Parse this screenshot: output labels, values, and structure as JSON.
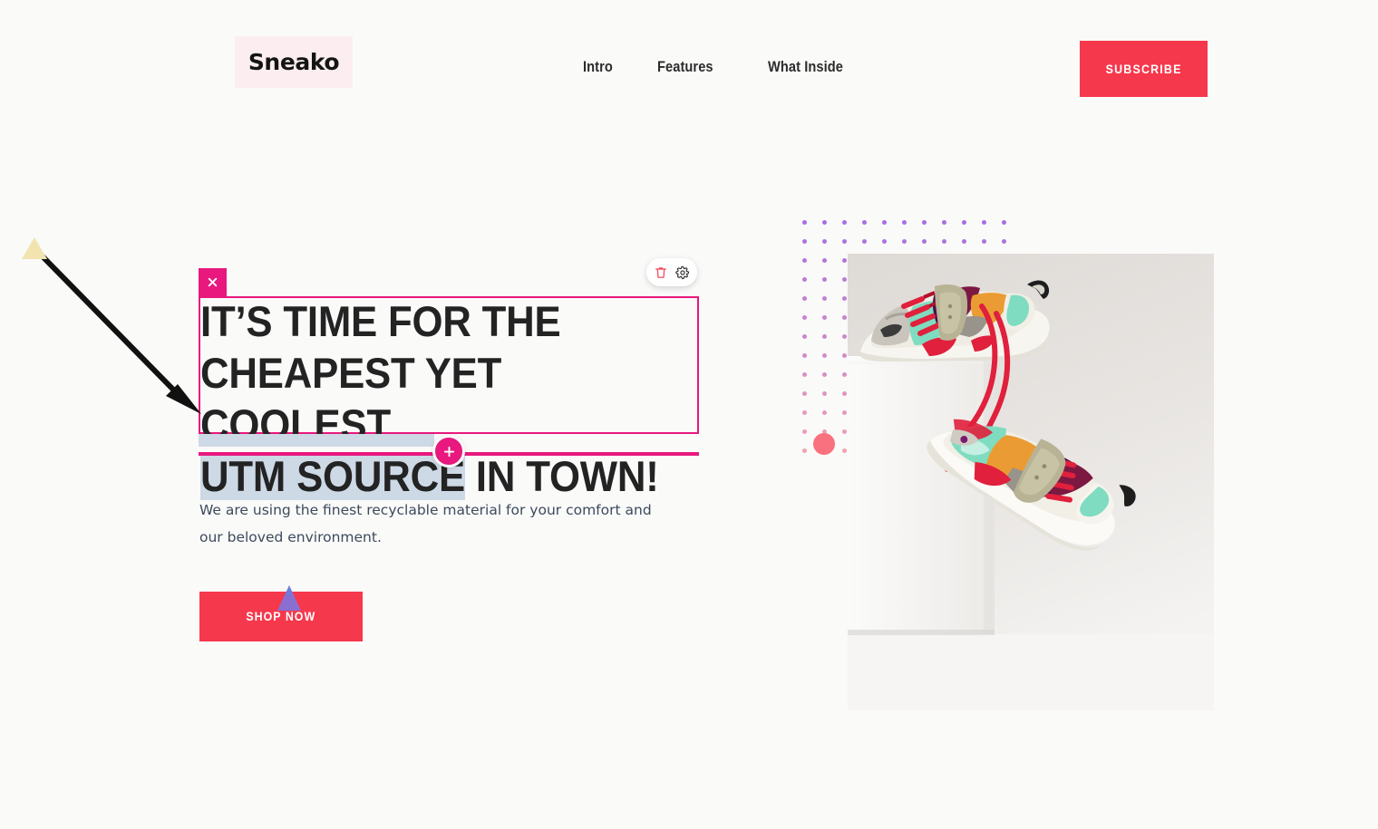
{
  "page": {
    "background_color": "#fafaf9",
    "accent_red": "#f6384c",
    "accent_magenta": "#e8187e",
    "selection_color": "#cdd9e5",
    "coral_color": "#f9707f"
  },
  "header": {
    "logo": {
      "text": "Sneako",
      "highlight_color": "#fceef0"
    },
    "nav": [
      {
        "label": "Intro"
      },
      {
        "label": "Features"
      },
      {
        "label": "What Inside"
      }
    ],
    "subscribe_button": {
      "label": "SUBSCRIBE",
      "color": "#f6384c"
    }
  },
  "editor": {
    "close_button": {
      "icon": "close-icon"
    },
    "toolbar": {
      "delete": {
        "icon": "trash-icon",
        "color": "#f0485a"
      },
      "settings": {
        "icon": "gear-icon",
        "color": "#2b2b2b"
      }
    },
    "add_block_button": {
      "icon": "plus-icon",
      "label": "+"
    },
    "selected_text": "UTM SOURCE"
  },
  "hero": {
    "headline_before": "IT’S TIME FOR THE\nCHEAPEST YET COOLEST\n",
    "headline_selected": "UTM SOURCE",
    "headline_after": " IN TOWN!",
    "paragraph": "We are using the finest recyclable material for your comfort and our beloved environment.",
    "cta_button": {
      "label": "SHOP NOW",
      "color": "#f6384c"
    }
  },
  "visual": {
    "product_alt": "Two colorful sneakers displayed on a white pedestal",
    "dot_pattern": {
      "rows": 13,
      "cols": 11,
      "top_color": "#a96ee0",
      "bottom_color": "#f3a0b6"
    },
    "coral_circle": {
      "color": "#f9707f"
    }
  },
  "annotations": {
    "arrow": {
      "color": "#111111",
      "from": "top-left",
      "to": "headline-selection"
    },
    "cursor_cream": {
      "color": "#f2e2ac"
    },
    "cursor_purple": {
      "color": "#8a6fd0"
    }
  }
}
